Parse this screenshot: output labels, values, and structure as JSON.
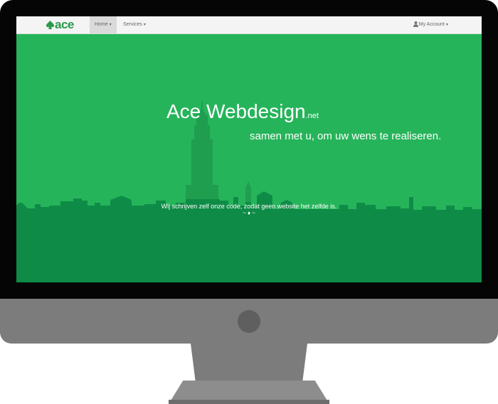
{
  "navbar": {
    "brand_logo": "ace",
    "brand_icon": "spade-icon",
    "home_label": "Home",
    "services_label": "Services",
    "account_label": "My Account",
    "caret_icon": "caret-down-icon",
    "account_icon": "user-icon"
  },
  "hero": {
    "title": "Ace Webdesign",
    "title_suffix": ".net",
    "subtitle": "samen met u, om uw wens te realiseren.",
    "tagline": "Wij schrijven zelf onze code, zodat geen website het zelfde is.",
    "ornament": "~ ♦ ~"
  },
  "colors": {
    "hero_top": "#26b45a",
    "skyline": "#0e8c47",
    "tower": "#1f9e50",
    "accent": "#2a9a4c",
    "bezel": "#050505",
    "monitor": "#7c7c7c"
  }
}
